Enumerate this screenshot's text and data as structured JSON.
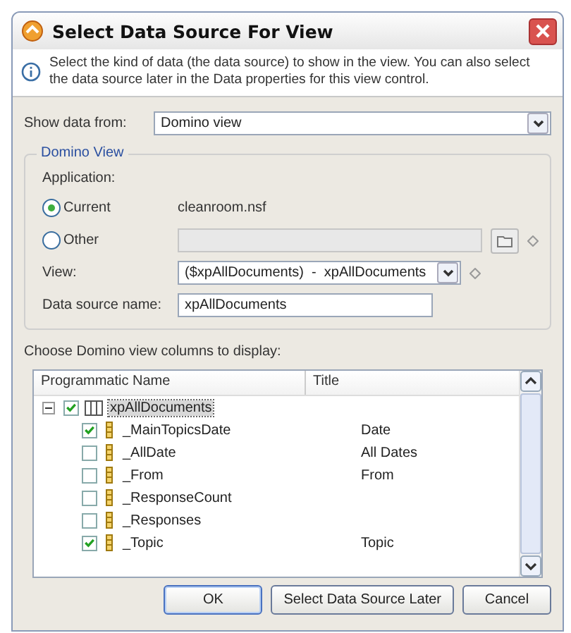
{
  "window": {
    "title": "Select Data Source For View"
  },
  "info": {
    "text": "Select the kind of data (the data source) to show in the view. You can also select the data source later in the Data properties for this view control."
  },
  "show_data_from": {
    "label": "Show data from:",
    "value": "Domino view"
  },
  "group": {
    "title": "Domino View",
    "application_label": "Application:",
    "options": [
      {
        "label": "Current",
        "selected": true,
        "value": "cleanroom.nsf"
      },
      {
        "label": "Other",
        "selected": false
      }
    ],
    "view": {
      "label": "View:",
      "value": "($xpAllDocuments)  -  xpAllDocuments"
    },
    "data_source_name": {
      "label": "Data source name:",
      "value": "xpAllDocuments"
    }
  },
  "columns_label": "Choose Domino view columns to display:",
  "table": {
    "columns": [
      "Programmatic Name",
      "Title"
    ],
    "root": {
      "name": "xpAllDocuments",
      "checked": true,
      "expanded": true,
      "selected": true,
      "children": [
        {
          "name": "_MainTopicsDate",
          "title": "Date",
          "checked": true
        },
        {
          "name": "_AllDate",
          "title": "All Dates",
          "checked": false
        },
        {
          "name": "_From",
          "title": "From",
          "checked": false
        },
        {
          "name": "_ResponseCount",
          "checked": false
        },
        {
          "name": "_Responses",
          "checked": false
        },
        {
          "name": "_Topic",
          "title": "Topic",
          "checked": true
        }
      ]
    }
  },
  "buttons": [
    {
      "label": "OK",
      "default": true
    },
    {
      "label": "Select Data Source Later",
      "default": false
    },
    {
      "label": "Cancel",
      "default": false
    }
  ]
}
